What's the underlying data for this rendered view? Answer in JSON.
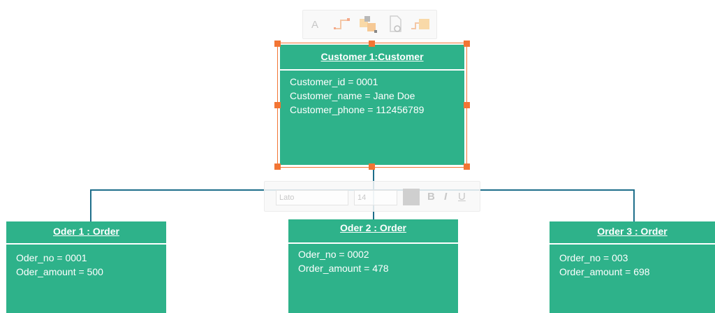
{
  "customer": {
    "title": "Customer 1:Customer",
    "attributes": [
      "Customer_id = 0001",
      "Customer_name = Jane Doe",
      "Customer_phone = 112456789"
    ]
  },
  "orders": [
    {
      "title": "Oder 1 : Order",
      "attributes": [
        "Oder_no = 0001",
        "Oder_amount = 500"
      ]
    },
    {
      "title": "Oder 2 : Order",
      "attributes": [
        "Oder_no = 0002",
        "Order_amount = 478"
      ]
    },
    {
      "title": "Order 3 : Order",
      "attributes": [
        "Order_no = 003",
        "Order_amount = 698"
      ]
    }
  ],
  "shape_toolbar": {
    "text_glyph": "A",
    "icons": [
      "connector-icon",
      "shape-style-icon",
      "page-settings-icon",
      "connector-shape-icon"
    ]
  },
  "text_toolbar": {
    "font_family": "Lato",
    "font_size": "14",
    "bold_label": "B",
    "italic_label": "I",
    "underline_label": "U"
  },
  "colors": {
    "box_fill": "#2eb28a",
    "connector": "#1e6e8a",
    "selection": "#f27534"
  }
}
